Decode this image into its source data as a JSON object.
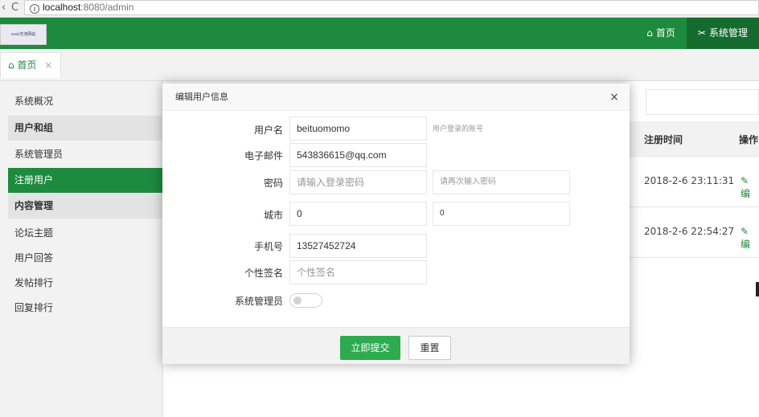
{
  "browser": {
    "back": "‹",
    "reload": "C",
    "url_host": "localhost",
    "url_rest": ":8080/admin"
  },
  "header": {
    "logo_text": "web交流网站",
    "nav": [
      {
        "label": "首页",
        "icon": "home-icon",
        "glyph": "⌂",
        "active": false
      },
      {
        "label": "系统管理",
        "icon": "tools-icon",
        "glyph": "✂",
        "active": true
      }
    ]
  },
  "tabs": [
    {
      "label": "首页",
      "icon": "home-icon",
      "glyph": "⌂",
      "close": "×"
    }
  ],
  "sidebar": {
    "items": [
      {
        "label": "系统概况",
        "type": "item"
      },
      {
        "label": "用户和组",
        "type": "group"
      },
      {
        "label": "系统管理员",
        "type": "item"
      },
      {
        "label": "注册用户",
        "type": "item",
        "active": true
      },
      {
        "label": "内容管理",
        "type": "group"
      },
      {
        "label": "论坛主题",
        "type": "item"
      },
      {
        "label": "用户回答",
        "type": "item"
      },
      {
        "label": "发帖排行",
        "type": "item"
      },
      {
        "label": "回复排行",
        "type": "item"
      }
    ]
  },
  "table": {
    "headers": {
      "reg_time": "注册时间",
      "op": "操作"
    },
    "rows": [
      {
        "reg_time": "2018-2-6 23:11:31",
        "op": "✎ 编"
      },
      {
        "reg_time": "2018-2-6 22:54:27",
        "op": "✎ 编"
      }
    ]
  },
  "modal": {
    "title": "编辑用户信息",
    "close": "×",
    "fields": {
      "username": {
        "label": "用户名",
        "value": "beituomomo",
        "hint": "用户登录的账号"
      },
      "email": {
        "label": "电子邮件",
        "value": "543836615@qq.com"
      },
      "password": {
        "label": "密码",
        "placeholder": "请输入登录密码",
        "confirm_placeholder": "请再次输入密码"
      },
      "city": {
        "label": "城市",
        "value": "0",
        "value2": "0"
      },
      "phone": {
        "label": "手机号",
        "value": "13527452724"
      },
      "signature": {
        "label": "个性签名",
        "placeholder": "个性签名"
      },
      "is_admin": {
        "label": "系统管理员",
        "checked": false
      }
    },
    "buttons": {
      "submit": "立即提交",
      "reset": "重置"
    }
  },
  "colors": {
    "brand_green": "#1e8a3e",
    "button_green": "#2eaa4f"
  }
}
